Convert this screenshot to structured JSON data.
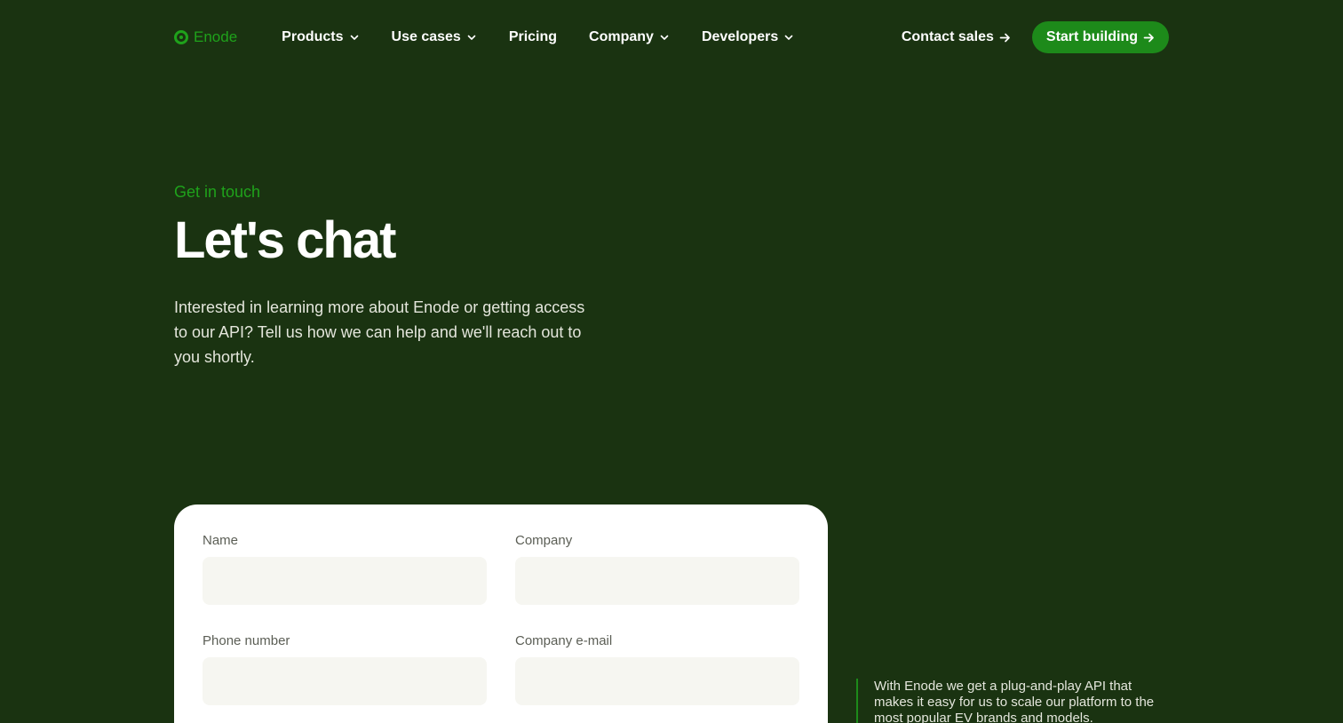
{
  "nav": {
    "brand": "Enode",
    "links": [
      {
        "label": "Products"
      },
      {
        "label": "Use cases"
      },
      {
        "label": "Pricing"
      },
      {
        "label": "Company"
      },
      {
        "label": "Developers"
      }
    ],
    "contact_label": "Contact sales",
    "cta_label": "Start building"
  },
  "hero": {
    "eyebrow": "Get in touch",
    "title": "Let's chat",
    "description": "Interested in learning more about Enode or getting access to our API? Tell us how we can help and we'll reach out to you shortly."
  },
  "form": {
    "fields": [
      {
        "label": "Name",
        "value": ""
      },
      {
        "label": "Company",
        "value": ""
      },
      {
        "label": "Phone number",
        "value": ""
      },
      {
        "label": "Company e-mail",
        "value": ""
      }
    ]
  },
  "testimonial": {
    "text": "With Enode we get a plug-and-play API that makes it easy for us to scale our platform to the most popular EV brands and models."
  },
  "colors": {
    "background": "#1a3311",
    "accent": "#1fa21b",
    "cta": "#1d8a1a",
    "card": "#ffffff",
    "input": "#f6f6f1"
  },
  "icons": {
    "brand": "enode-logo-icon",
    "dropdown": "chevron-down-icon",
    "arrow": "arrow-right-icon"
  }
}
